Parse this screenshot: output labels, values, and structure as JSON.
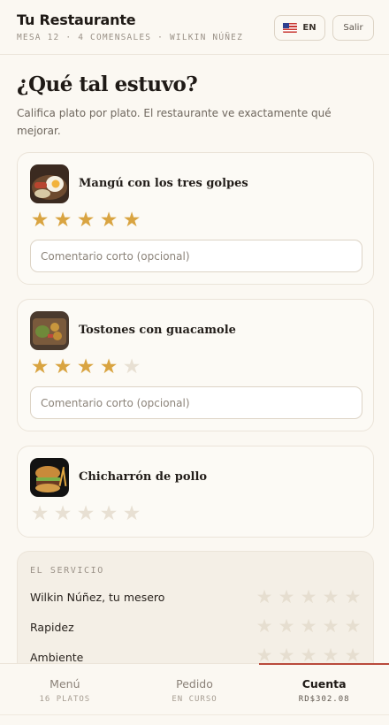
{
  "header": {
    "title": "Tu Restaurante",
    "subtitle": "MESA 12 · 4 COMENSALES · WILKIN NÚÑEZ",
    "lang_label": "EN",
    "logout_label": "Salir"
  },
  "page": {
    "title": "¿Qué tal estuvo?",
    "intro": "Califica plato por plato. El restaurante ve exactamente qué mejorar."
  },
  "dishes": [
    {
      "name": "Mangú con los tres golpes",
      "rating": 5,
      "comment_placeholder": "Comentario corto (opcional)"
    },
    {
      "name": "Tostones con guacamole",
      "rating": 4,
      "comment_placeholder": "Comentario corto (opcional)"
    },
    {
      "name": "Chicharrón de pollo",
      "rating": 0
    }
  ],
  "service": {
    "title": "EL SERVICIO",
    "rows": [
      {
        "label": "Wilkin Núñez, tu mesero",
        "rating": 0
      },
      {
        "label": "Rapidez",
        "rating": 0
      },
      {
        "label": "Ambiente",
        "rating": 0
      }
    ]
  },
  "nav": [
    {
      "label": "Menú",
      "sub": "16 PLATOS"
    },
    {
      "label": "Pedido",
      "sub": "EN CURSO"
    },
    {
      "label": "Cuenta",
      "sub": "RD$302.08",
      "active": true
    }
  ],
  "colors": {
    "accent": "#b94a3c",
    "star_on": "#d9a441",
    "star_off": "#e8e0d3"
  }
}
